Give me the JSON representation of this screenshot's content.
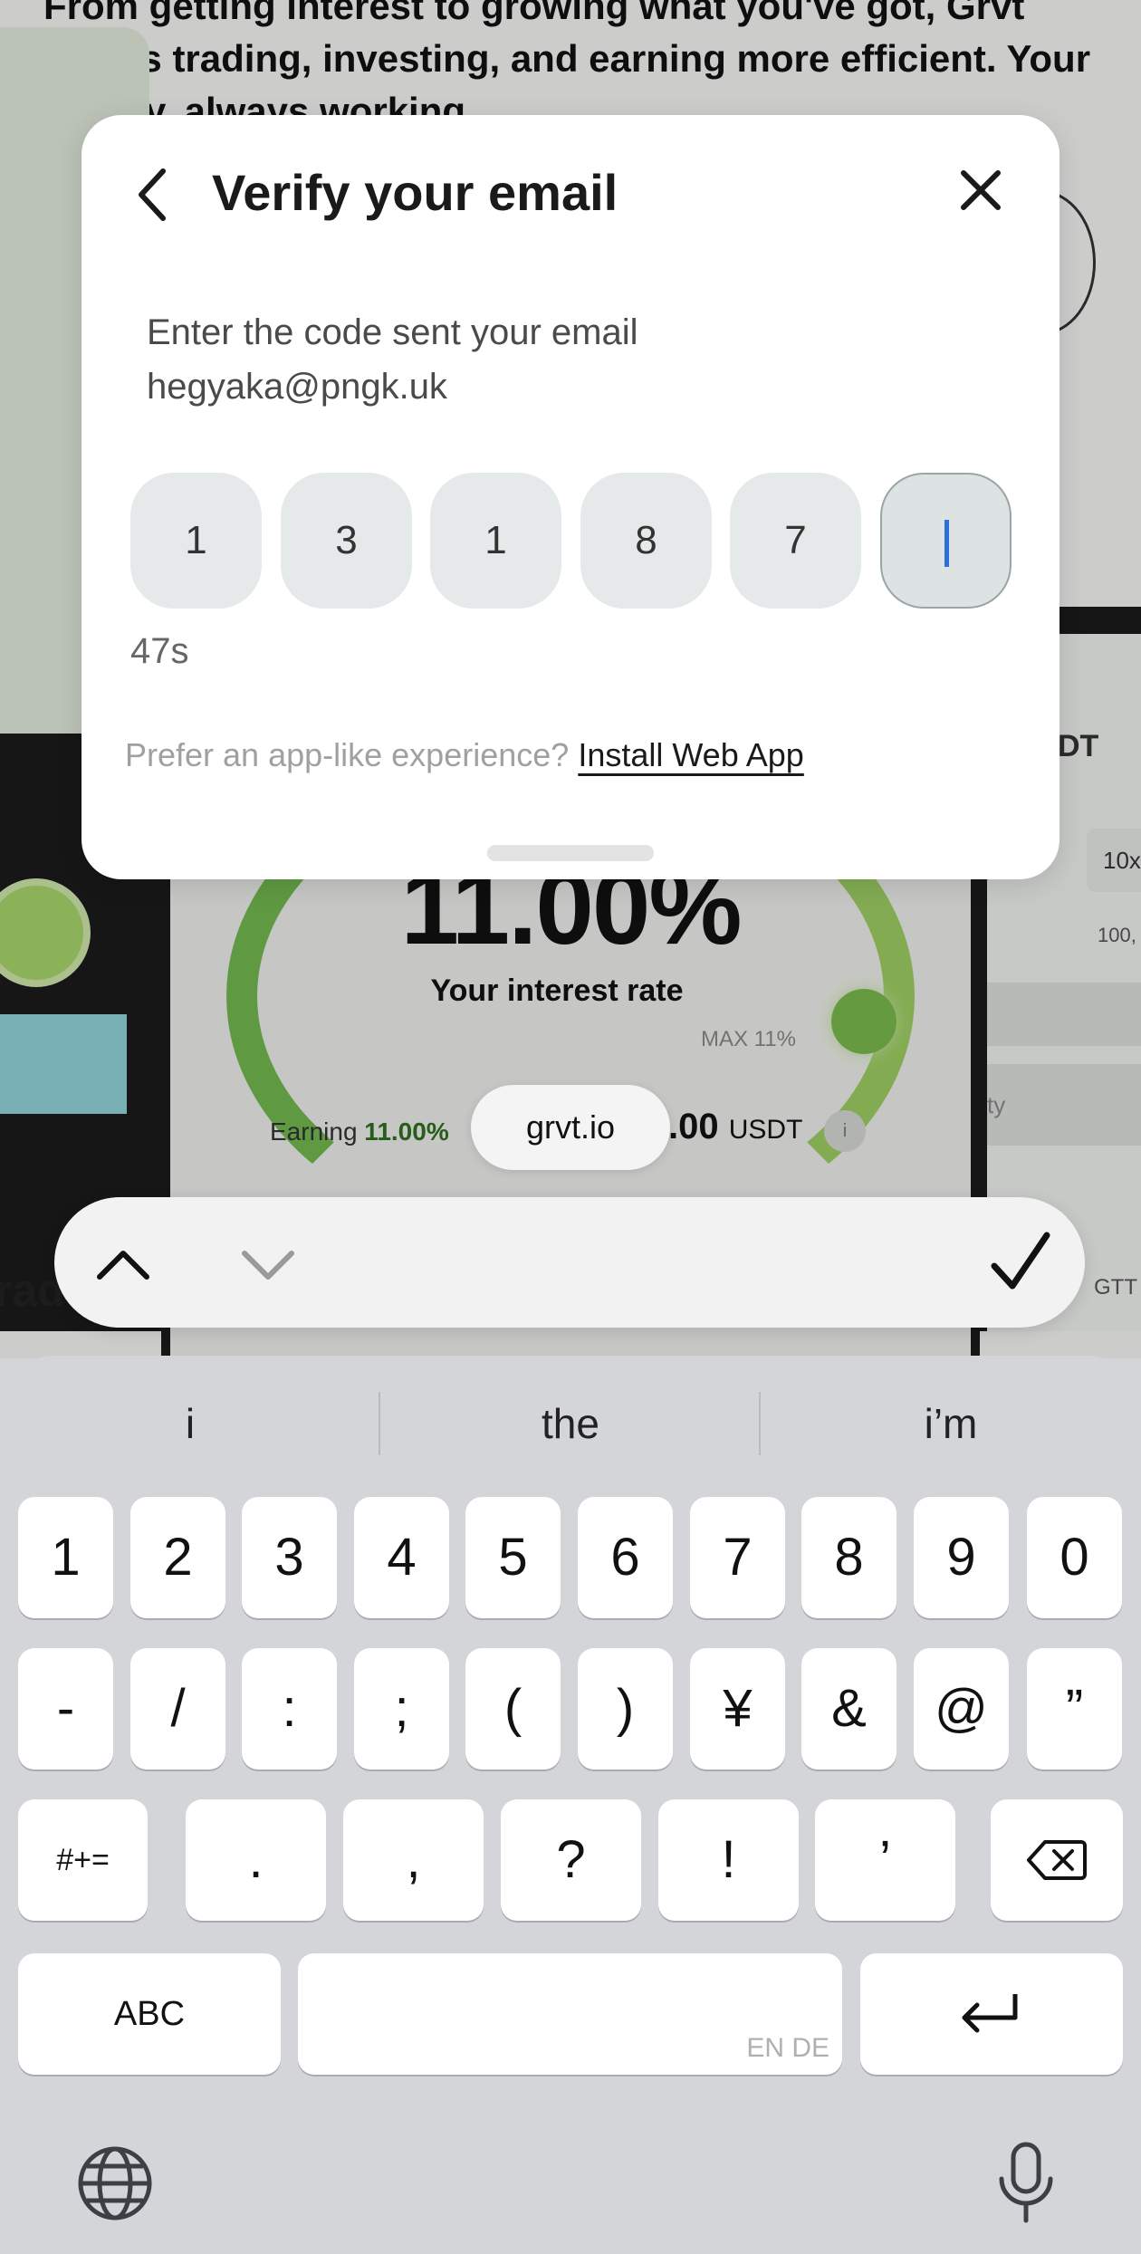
{
  "background": {
    "intro_text": "From getting interest to growing what you've got, Grvt makes trading, investing, and earning more efficient. Your money, always working.",
    "rate_value": "11.00%",
    "rate_label": "Your interest rate",
    "max_label": "MAX 11%",
    "earning_prefix": "Earning",
    "earning_rate": "11.00%",
    "earning_amount": ".00",
    "earning_unit": "USDT",
    "info_icon": "i",
    "right_ticker": "DT",
    "right_chip": "10x",
    "right_amount": "100,",
    "right_field": "ty",
    "right_token": "GTT",
    "section_title": "rade"
  },
  "modal": {
    "title": "Verify your email",
    "subtitle_line1": "Enter the code sent your email",
    "subtitle_line2": "hegyaka@pngk.uk",
    "otp_digits": [
      "1",
      "3",
      "1",
      "8",
      "7",
      ""
    ],
    "timer": "47s",
    "prefer_text": "Prefer an app-like experience?",
    "install_link": "Install Web App"
  },
  "browser": {
    "url": "grvt.io"
  },
  "keyboard": {
    "suggestions": [
      "i",
      "the",
      "i’m"
    ],
    "row1": [
      "1",
      "2",
      "3",
      "4",
      "5",
      "6",
      "7",
      "8",
      "9",
      "0"
    ],
    "row2": [
      "-",
      "/",
      ":",
      ";",
      "(",
      ")",
      "¥",
      "&",
      "@",
      "”"
    ],
    "row3": [
      "#+=",
      ".",
      ",",
      "?",
      "!",
      "’"
    ],
    "abc_label": "ABC",
    "language_hint": "EN DE"
  },
  "colors": {
    "accent_green": "#8fbd57",
    "cursor_blue": "#2b6fd8",
    "keyboard_bg": "#d3d5d9"
  }
}
